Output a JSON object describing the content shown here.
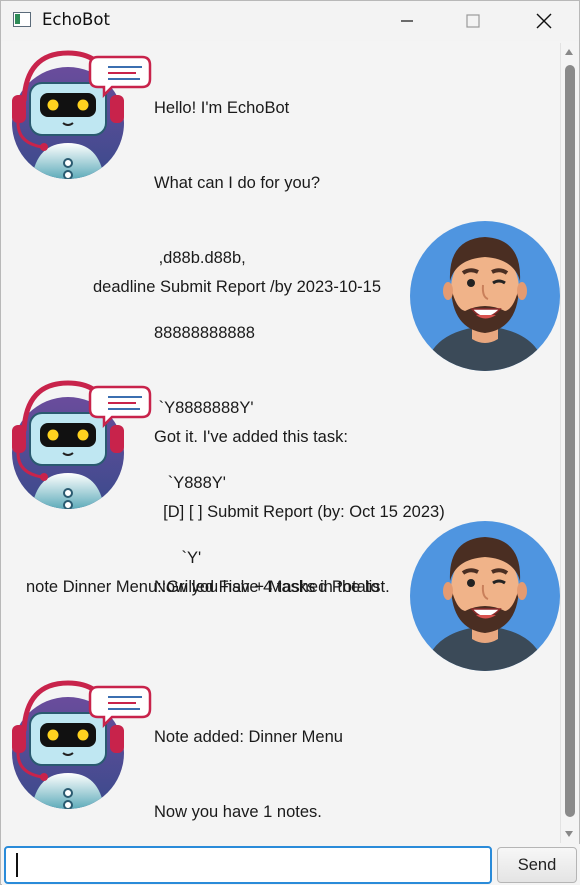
{
  "window": {
    "title": "EchoBot"
  },
  "conversation": {
    "bot_greeting": {
      "lines": [
        "Hello! I'm EchoBot",
        "What can I do for you?",
        " ,d88b.d88b,",
        "88888888888",
        " `Y8888888Y'",
        "   `Y888Y'",
        "      `Y'"
      ]
    },
    "user_message_1": {
      "text": "deadline Submit Report /by 2023-10-15"
    },
    "bot_reply_1": {
      "lines": [
        "Got it. I've added this task:",
        "  [D] [ ] Submit Report (by: Oct 15 2023)",
        "Now you have 4 tasks in the list."
      ]
    },
    "user_message_2": {
      "text": "note Dinner Menu::Grilled Fish + Mashed Potato"
    },
    "bot_reply_2": {
      "lines": [
        "Note added: Dinner Menu",
        "Now you have 1 notes."
      ]
    }
  },
  "input": {
    "value": "",
    "send_label": "Send"
  },
  "colors": {
    "accent": "#2a8bd9",
    "user_avatar_bg": "#4f95e0",
    "bot_headset": "#c8234b"
  },
  "icons": {
    "bot_avatar": "robot-icon",
    "user_avatar": "man-bearded-icon"
  }
}
